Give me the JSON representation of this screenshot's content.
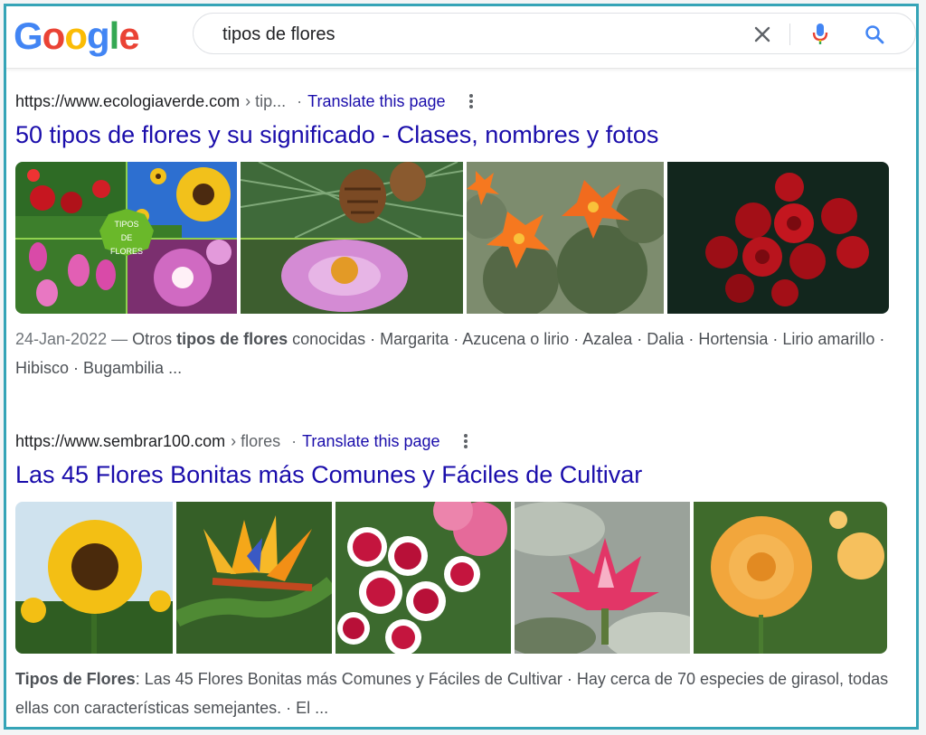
{
  "search": {
    "query": "tipos de flores",
    "logo_letters": [
      {
        "ch": "G",
        "color": "#4285f4"
      },
      {
        "ch": "o",
        "color": "#ea4335"
      },
      {
        "ch": "o",
        "color": "#fbbc05"
      },
      {
        "ch": "g",
        "color": "#4285f4"
      },
      {
        "ch": "l",
        "color": "#34a853"
      },
      {
        "ch": "e",
        "color": "#ea4335"
      }
    ],
    "icons": [
      "close-icon",
      "mic-icon",
      "search-icon"
    ]
  },
  "results": [
    {
      "site": "https://www.ecologiaverde.com",
      "crumb": "› tip...",
      "translate": "Translate this page",
      "title": "50 tipos de flores y su significado - Clases, nombres y fotos",
      "collage_badge": [
        "TIPOS",
        "DE",
        "FLORES"
      ],
      "snippet_date": "24-Jan-2022 —",
      "snippet_pre": " Otros ",
      "snippet_bold": "tipos de flores",
      "snippet_post": " conocidas · Margarita · Azucena o lirio · Azalea · Dalia · Hortensia · Lirio amarillo · Hibisco · Bugambilia ..."
    },
    {
      "site": "https://www.sembrar100.com",
      "crumb": "› flores",
      "translate": "Translate this page",
      "title": "Las 45 Flores Bonitas más Comunes y Fáciles de Cultivar",
      "snippet_bold": "Tipos de Flores",
      "snippet_post": ": Las 45 Flores Bonitas más Comunes y Fáciles de Cultivar · Hay cerca de 70 especies de girasol, todas ellas con características semejantes. · El ..."
    }
  ],
  "colors": {
    "link": "#1a0dab",
    "frame": "#35a4b7"
  }
}
